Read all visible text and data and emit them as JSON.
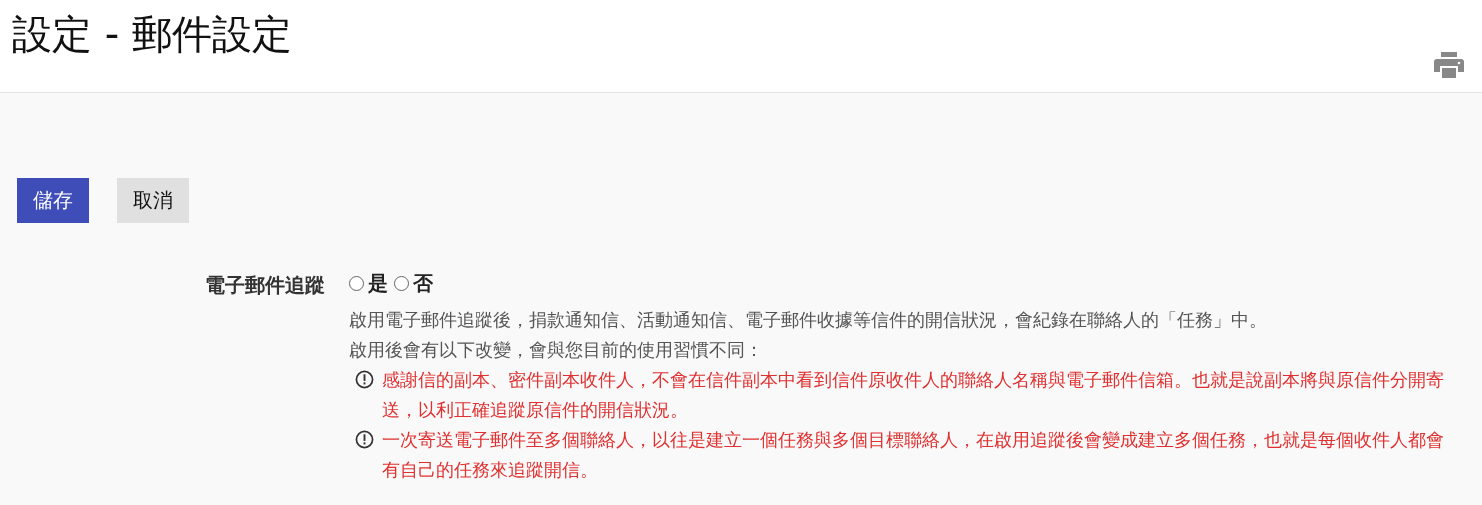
{
  "page_title": "設定 - 郵件設定",
  "buttons": [
    {
      "kind": "primary",
      "label": "儲存"
    },
    {
      "kind": "secondary",
      "label": "取消"
    }
  ],
  "field": {
    "label": "電子郵件追蹤",
    "options": [
      {
        "label": "是",
        "selected": false
      },
      {
        "label": "否",
        "selected": false
      }
    ],
    "description": [
      "啟用電子郵件追蹤後，捐款通知信、活動通知信、電子郵件收據等信件的開信狀況，會紀錄在聯絡人的「任務」中。",
      "啟用後會有以下改變，會與您目前的使用習慣不同："
    ],
    "warnings": [
      "感謝信的副本、密件副本收件人，不會在信件副本中看到信件原收件人的聯絡人名稱與電子郵件信箱。也就是說副本將與原信件分開寄送，以利正確追蹤原信件的開信狀況。",
      "一次寄送電子郵件至多個聯絡人，以往是建立一個任務與多個目標聯絡人，在啟用追蹤後會變成建立多個任務，也就是每個收件人都會有自己的任務來追蹤開信。"
    ]
  }
}
